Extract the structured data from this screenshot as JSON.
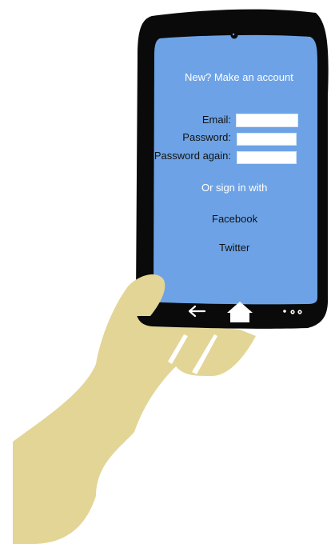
{
  "signup": {
    "title": "New? Make an account",
    "email_label": "Email:",
    "email_value": "",
    "password_label": "Password:",
    "password_value": "",
    "password_again_label": "Password again:",
    "password_again_value": ""
  },
  "social": {
    "or_text": "Or sign in with",
    "facebook_label": "Facebook",
    "twitter_label": "Twitter"
  },
  "icons": {
    "camera": "camera-icon",
    "back": "back-arrow-icon",
    "home": "home-icon",
    "menu": "menu-dots-icon"
  },
  "colors": {
    "screen": "#6da3e6",
    "phone_body": "#0a0a0a",
    "hand": "#e2d596",
    "screen_text": "#ffffff",
    "label_text": "#111111"
  }
}
